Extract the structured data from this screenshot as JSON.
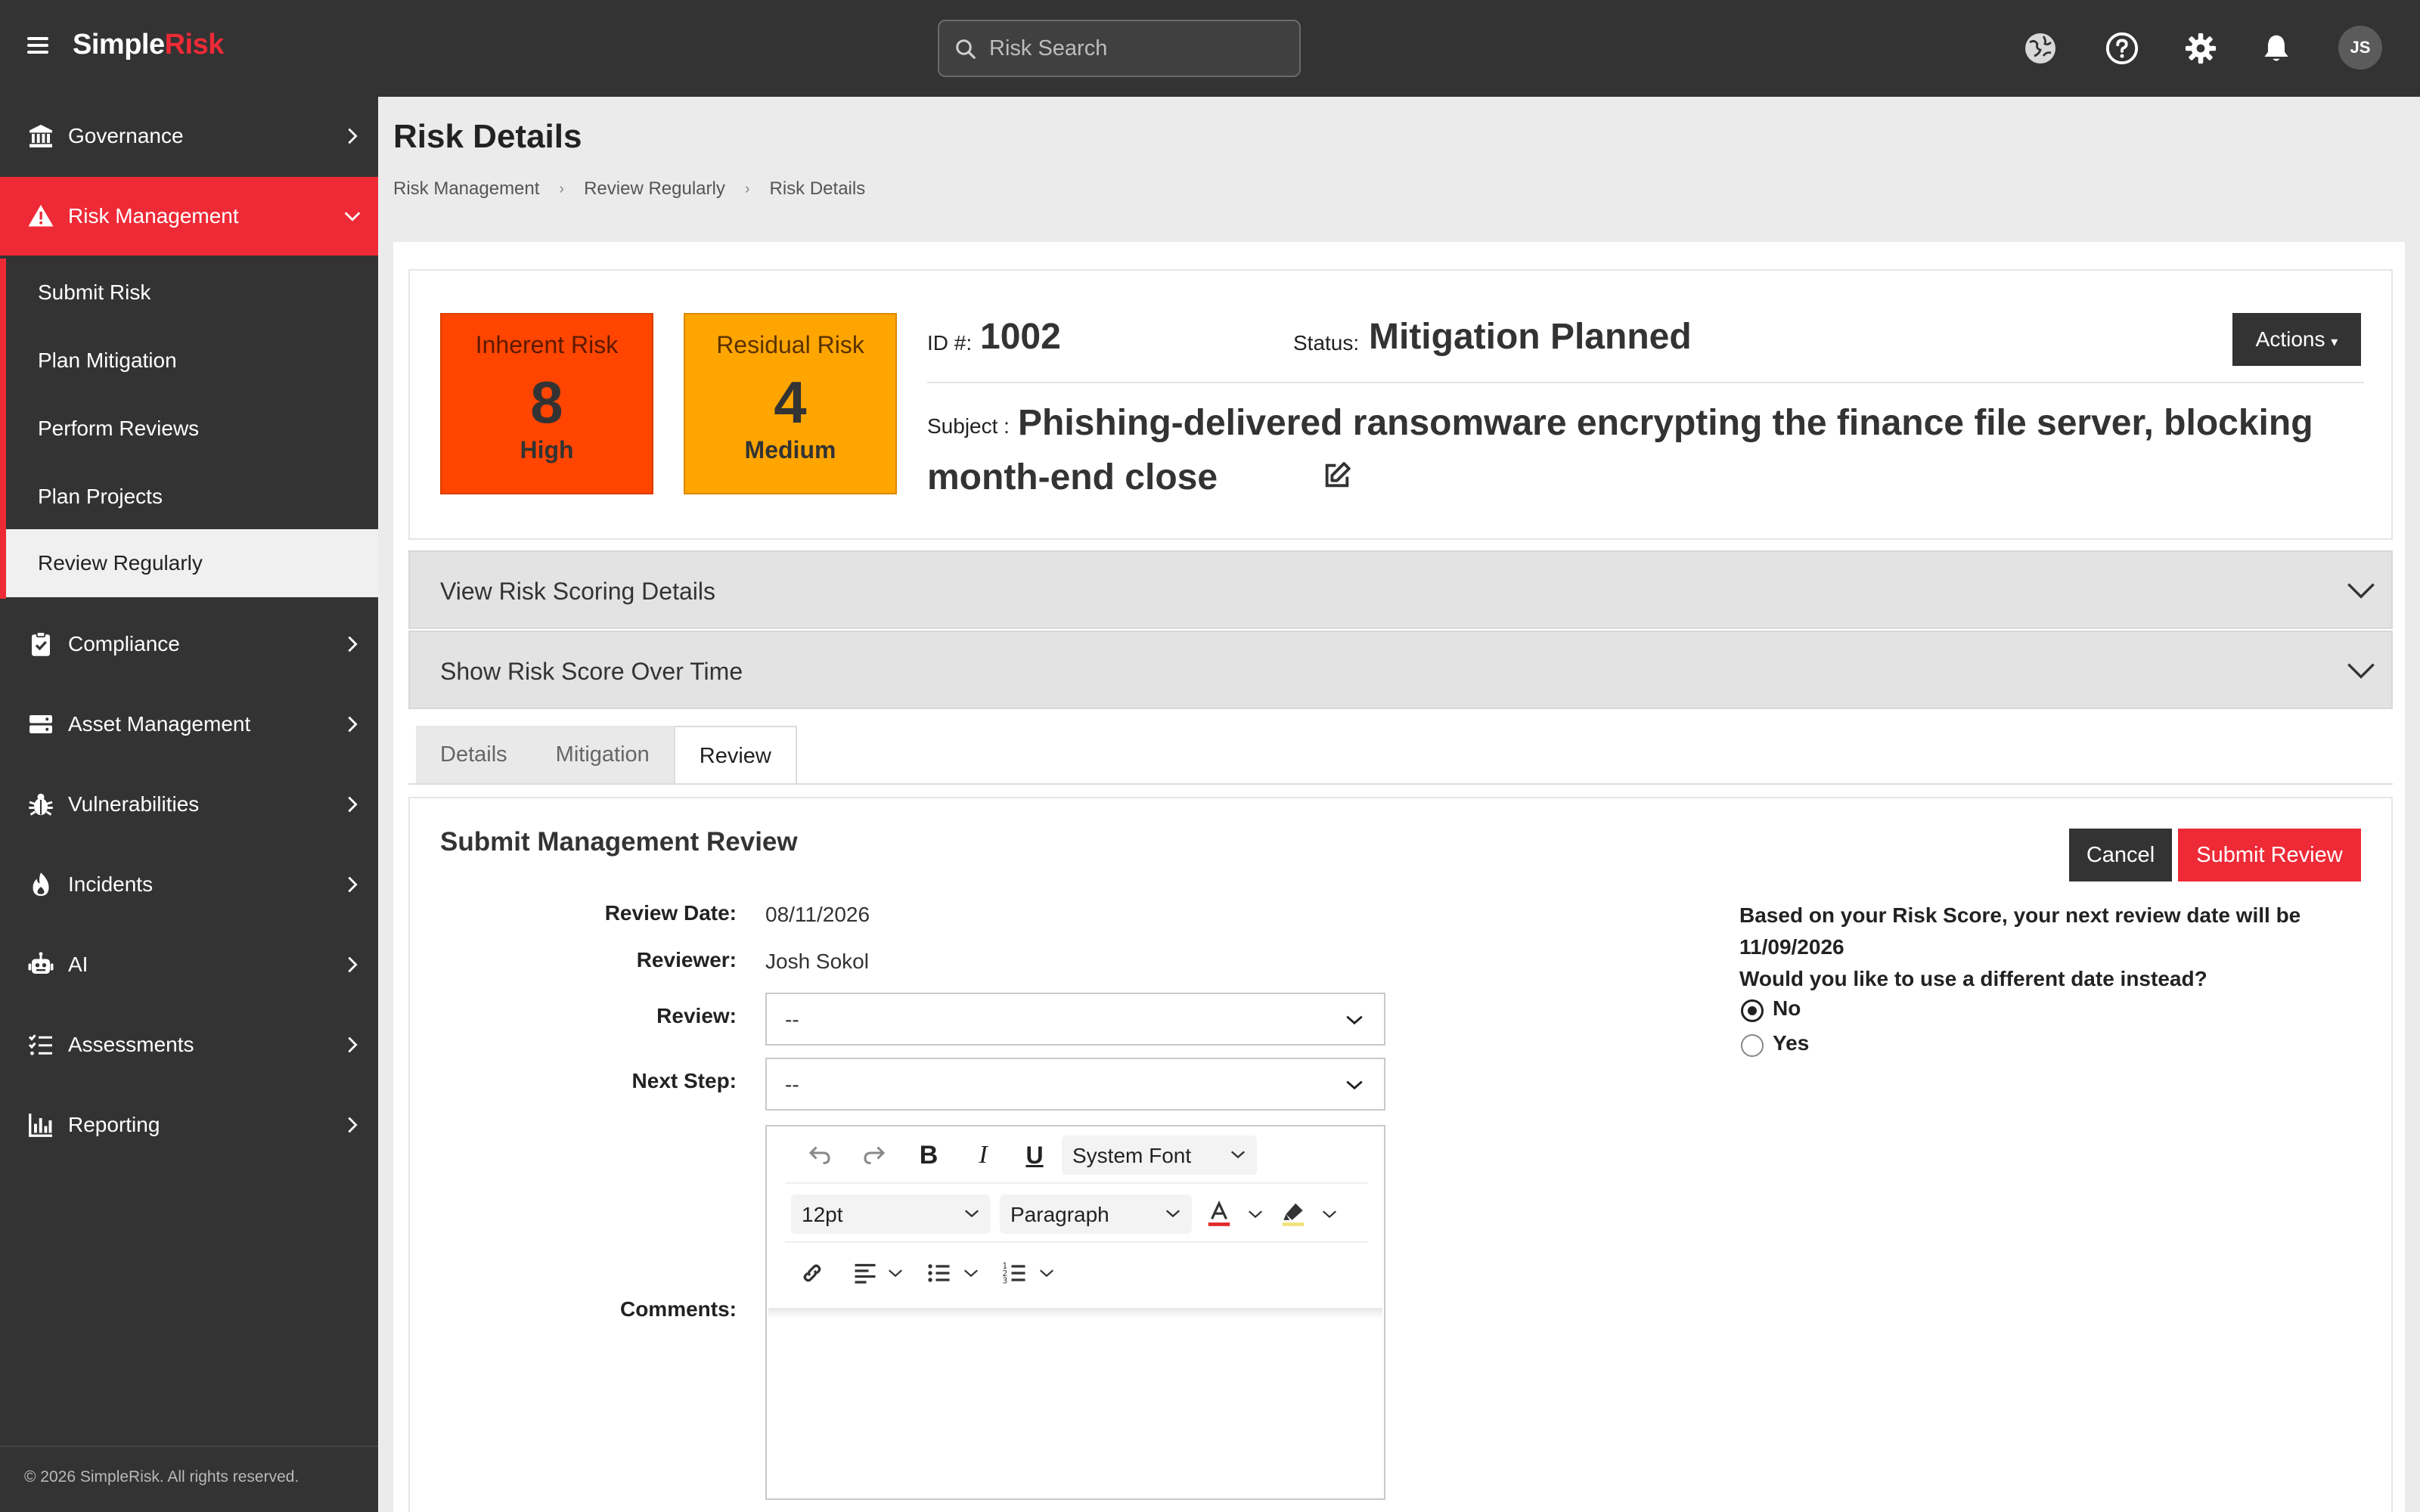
{
  "header": {
    "brand_part1": "Simple",
    "brand_part2": "Risk",
    "search_placeholder": "Risk Search",
    "avatar_initials": "JS"
  },
  "sidebar": {
    "items": [
      {
        "label": "Governance",
        "icon": "bank-icon"
      },
      {
        "label": "Risk Management",
        "icon": "warning-icon",
        "active": true
      },
      {
        "label": "Compliance",
        "icon": "clipboard-check-icon"
      },
      {
        "label": "Asset Management",
        "icon": "server-icon"
      },
      {
        "label": "Vulnerabilities",
        "icon": "bug-icon"
      },
      {
        "label": "Incidents",
        "icon": "fire-icon"
      },
      {
        "label": "AI",
        "icon": "robot-icon"
      },
      {
        "label": "Assessments",
        "icon": "list-check-icon"
      },
      {
        "label": "Reporting",
        "icon": "bar-chart-icon"
      }
    ],
    "sub_items": [
      "Submit Risk",
      "Plan Mitigation",
      "Perform Reviews",
      "Plan Projects",
      "Review Regularly"
    ],
    "selected_sub_item": "Review Regularly",
    "footer": "© 2026 SimpleRisk. All rights reserved."
  },
  "page": {
    "title": "Risk Details",
    "breadcrumb": [
      "Risk Management",
      "Review Regularly",
      "Risk Details"
    ]
  },
  "risk": {
    "inherent": {
      "title": "Inherent Risk",
      "score": "8",
      "level": "High",
      "color": "#ff4500"
    },
    "residual": {
      "title": "Residual Risk",
      "score": "4",
      "level": "Medium",
      "color": "#ffa500"
    },
    "id_label": "ID #:",
    "id": "1002",
    "status_label": "Status:",
    "status": "Mitigation Planned",
    "actions_label": "Actions",
    "subject_label": "Subject :",
    "subject": "Phishing-delivered ransomware encrypting the finance file server, blocking month-end close"
  },
  "accordions": [
    "View Risk Scoring Details",
    "Show Risk Score Over Time"
  ],
  "tabs": [
    {
      "label": "Details"
    },
    {
      "label": "Mitigation"
    },
    {
      "label": "Review",
      "active": true
    }
  ],
  "review_form": {
    "title": "Submit Management Review",
    "cancel_label": "Cancel",
    "submit_label": "Submit Review",
    "review_date_label": "Review Date:",
    "review_date": "08/11/2026",
    "reviewer_label": "Reviewer:",
    "reviewer": "Josh Sokol",
    "review_label": "Review:",
    "review_value": "--",
    "next_step_label": "Next Step:",
    "next_step_value": "--",
    "comments_label": "Comments:",
    "editor": {
      "font_family": "System Font",
      "font_size": "12pt",
      "block_format": "Paragraph"
    },
    "next_review_text": "Based on your Risk Score, your next review date will be",
    "next_review_date": "11/09/2026",
    "different_date_question": "Would you like to use a different date instead?",
    "options": [
      {
        "label": "No",
        "checked": true
      },
      {
        "label": "Yes",
        "checked": false
      }
    ]
  },
  "colors": {
    "accent": "#ee2a37",
    "dark": "#333333"
  }
}
